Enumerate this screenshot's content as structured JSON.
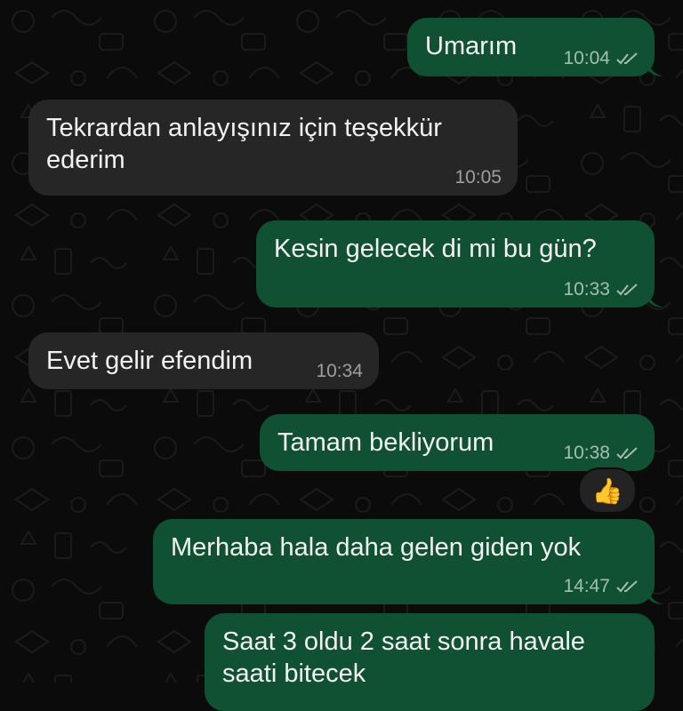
{
  "chat": {
    "messages": [
      {
        "direction": "out",
        "text": "Umarım",
        "time": "10:04",
        "status": "read"
      },
      {
        "direction": "in",
        "text": "Tekrardan anlayışınız için teşekkür\nederim",
        "time": "10:05"
      },
      {
        "direction": "out",
        "text": "Kesin gelecek di mi bu gün?",
        "time": "10:33",
        "status": "read"
      },
      {
        "direction": "in",
        "text": "Evet gelir efendim",
        "time": "10:34"
      },
      {
        "direction": "out",
        "text": "Tamam bekliyorum",
        "time": "10:38",
        "status": "read",
        "reaction": "👍"
      },
      {
        "direction": "out",
        "text": "Merhaba hala daha gelen giden yok",
        "time": "14:47",
        "status": "read"
      },
      {
        "direction": "out",
        "text": "Saat 3 oldu 2 saat sonra havale\nsaati bitecek",
        "time": "",
        "status": "read"
      }
    ]
  },
  "colors": {
    "background": "#0b0b0b",
    "outgoing_bubble": "#0f5132",
    "incoming_bubble": "#262626",
    "text": "#f2f2f2"
  },
  "icons": {
    "read_receipt": "double-check-icon",
    "reaction": "thumbs-up-icon"
  }
}
